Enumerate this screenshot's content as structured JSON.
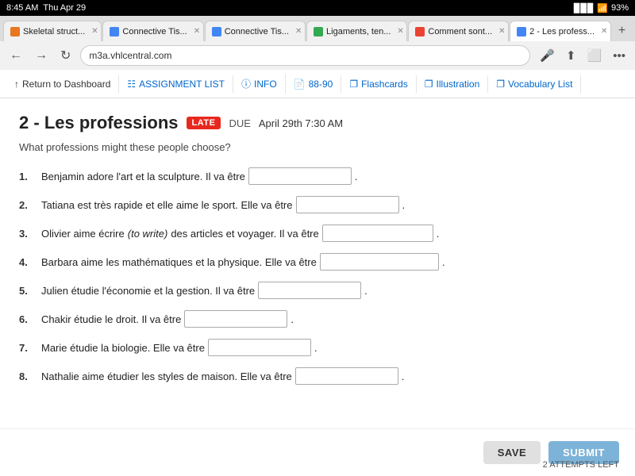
{
  "status_bar": {
    "time": "8:45 AM",
    "day": "Thu Apr 29",
    "signal": "▉▉▉",
    "wifi": "WiFi",
    "battery": "93%"
  },
  "browser": {
    "tabs": [
      {
        "id": 1,
        "icon_color": "#e87722",
        "label": "Skeletal struct...",
        "active": false
      },
      {
        "id": 2,
        "icon_color": "#4285f4",
        "label": "Connective Tis...",
        "active": false
      },
      {
        "id": 3,
        "icon_color": "#4285f4",
        "label": "Connective Tis...",
        "active": false
      },
      {
        "id": 4,
        "icon_color": "#34a853",
        "label": "Ligaments, ten...",
        "active": false
      },
      {
        "id": 5,
        "icon_color": "#ea4335",
        "label": "Comment sont...",
        "active": false
      },
      {
        "id": 6,
        "icon_color": "#4285f4",
        "label": "2 - Les profess...",
        "active": true
      }
    ],
    "url": "m3a.vhlcentral.com",
    "back_enabled": true,
    "forward_enabled": true
  },
  "toolbar": {
    "return_label": "Return to Dashboard",
    "assignment_list_label": "ASSIGNMENT LIST",
    "info_label": "INFO",
    "pages_label": "88-90",
    "flashcards_label": "Flashcards",
    "illustration_label": "Illustration",
    "vocabulary_list_label": "Vocabulary List"
  },
  "page": {
    "number": "2",
    "title": "Les professions",
    "late_badge": "LATE",
    "due_label": "DUE",
    "due_date": "April 29th 7:30 AM",
    "prompt": "What professions might these people choose?"
  },
  "questions": [
    {
      "number": "1.",
      "text_before": "Benjamin adore l’art et la sculpture. Il va être",
      "text_after": ".",
      "input_width": 130
    },
    {
      "number": "2.",
      "text_before": "Tatiana est très rapide et elle aime le sport. Elle va être",
      "text_after": ".",
      "input_width": 130
    },
    {
      "number": "3.",
      "text_before": "Olivier aime écrire",
      "italic": "(to write)",
      "text_middle": "des articles et voyager. Il va être",
      "text_after": ".",
      "input_width": 140
    },
    {
      "number": "4.",
      "text_before": "Barbara aime les mathématiques et la physique. Elle va être",
      "text_after": ".",
      "input_width": 150
    },
    {
      "number": "5.",
      "text_before": "Julien étudie l’économie et la gestion. Il va être",
      "text_after": ".",
      "input_width": 130
    },
    {
      "number": "6.",
      "text_before": "Chakir étudie le droit. Il va être",
      "text_after": ".",
      "input_width": 130
    },
    {
      "number": "7.",
      "text_before": "Marie étudie la biologie. Elle va être",
      "text_after": ".",
      "input_width": 130
    },
    {
      "number": "8.",
      "text_before": "Nathalie aime étudier les styles de maison. Elle va être",
      "text_after": ".",
      "input_width": 130
    }
  ],
  "footer": {
    "save_label": "SAVE",
    "submit_label": "SUBMIT",
    "attempts_text": "2 ATTEMPTS LEFT"
  }
}
